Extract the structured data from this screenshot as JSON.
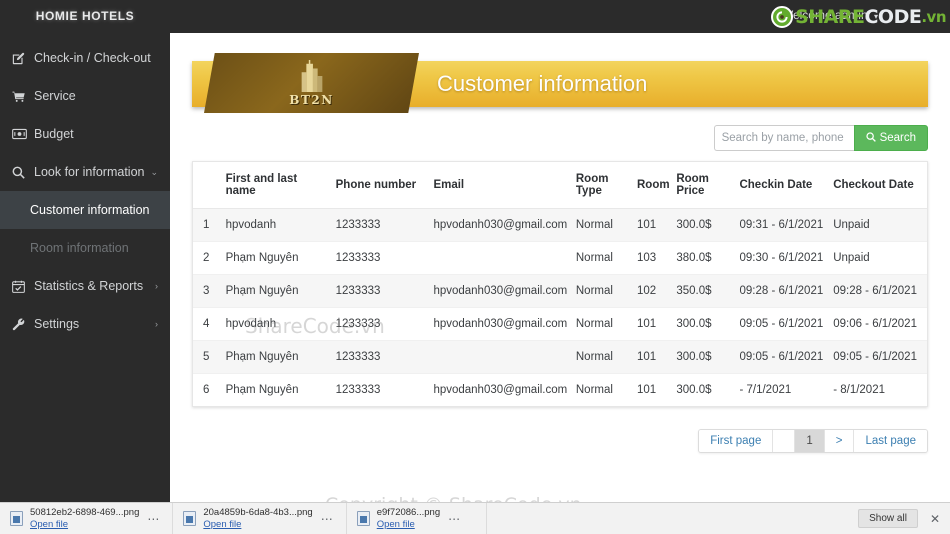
{
  "app": {
    "brand": "HOMIE HOTELS",
    "welcome": "Welcome admin"
  },
  "watermark": {
    "logo_share": "SHARE",
    "logo_code": "CODE",
    "logo_vn": ".vn",
    "table_text": "ShareCode.vn",
    "copyright_text": "Copyright © ShareCode.vn"
  },
  "sidebar": {
    "items": [
      {
        "label": "Check-in / Check-out",
        "icon": "edit-square-icon",
        "caret": ""
      },
      {
        "label": "Service",
        "icon": "cart-icon",
        "caret": ""
      },
      {
        "label": "Budget",
        "icon": "money-icon",
        "caret": ""
      },
      {
        "label": "Look for information",
        "icon": "search-icon",
        "caret": "⌄"
      },
      {
        "label": "Statistics & Reports",
        "icon": "calendar-check-icon",
        "caret": "›"
      },
      {
        "label": "Settings",
        "icon": "wrench-icon",
        "caret": "›"
      }
    ],
    "sub_items": [
      {
        "label": "Customer information",
        "state": "active"
      },
      {
        "label": "Room information",
        "state": "dim"
      }
    ]
  },
  "banner": {
    "title": "Customer information",
    "emblem_text": "BT2N"
  },
  "search": {
    "placeholder": "Search by name, phone number",
    "value": "",
    "button_label": "Search"
  },
  "table": {
    "columns": [
      "",
      "First and last name",
      "Phone number",
      "Email",
      "Room Type",
      "Room",
      "Room Price",
      "Checkin Date",
      "Checkout Date"
    ],
    "rows": [
      {
        "idx": "1",
        "name": "hpvodanh",
        "phone": "1233333",
        "email": "hpvodanh030@gmail.com",
        "room_type": "Normal",
        "room": "101",
        "price": "300.0$",
        "checkin": "09:31 - 6/1/2021",
        "checkout": "Unpaid"
      },
      {
        "idx": "2",
        "name": "Phạm Nguyên",
        "phone": "1233333",
        "email": "",
        "room_type": "Normal",
        "room": "103",
        "price": "380.0$",
        "checkin": "09:30 - 6/1/2021",
        "checkout": "Unpaid"
      },
      {
        "idx": "3",
        "name": "Phạm Nguyên",
        "phone": "1233333",
        "email": "hpvodanh030@gmail.com",
        "room_type": "Normal",
        "room": "102",
        "price": "350.0$",
        "checkin": "09:28 - 6/1/2021",
        "checkout": "09:28 - 6/1/2021"
      },
      {
        "idx": "4",
        "name": "hpvodanh",
        "phone": "1233333",
        "email": "hpvodanh030@gmail.com",
        "room_type": "Normal",
        "room": "101",
        "price": "300.0$",
        "checkin": "09:05 - 6/1/2021",
        "checkout": "09:06 - 6/1/2021"
      },
      {
        "idx": "5",
        "name": "Phạm Nguyên",
        "phone": "1233333",
        "email": "",
        "room_type": "Normal",
        "room": "101",
        "price": "300.0$",
        "checkin": "09:05 - 6/1/2021",
        "checkout": "09:05 - 6/1/2021"
      },
      {
        "idx": "6",
        "name": "Phạm Nguyên",
        "phone": "1233333",
        "email": "hpvodanh030@gmail.com",
        "room_type": "Normal",
        "room": "101",
        "price": "300.0$",
        "checkin": "- 7/1/2021",
        "checkout": "- 8/1/2021"
      }
    ]
  },
  "pagination": {
    "first_label": "First page",
    "gap_label": "",
    "current_label": "1",
    "next_label": ">",
    "last_label": "Last page"
  },
  "downloads": {
    "items": [
      {
        "name": "50812eb2-6898-469...png",
        "action": "Open file",
        "menu": "⋯"
      },
      {
        "name": "20a4859b-6da8-4b3...png",
        "action": "Open file",
        "menu": "⋯"
      },
      {
        "name": "e9f72086...png",
        "action": "Open file",
        "menu": "⋯"
      }
    ],
    "show_all_label": "Show all",
    "close_label": "✕"
  },
  "colors": {
    "sidebar_bg": "#2b2b2b",
    "active_item": "#3d4246",
    "accent_green": "#5cb85c",
    "banner_gold": "#efc746",
    "link_blue": "#3c7fb1"
  }
}
